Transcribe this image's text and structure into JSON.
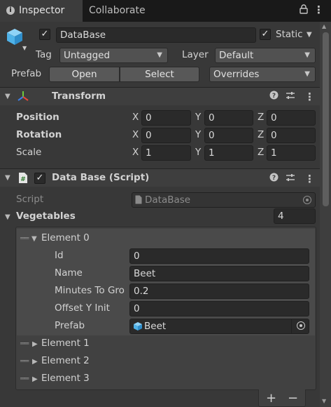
{
  "tabs": [
    {
      "label": "Inspector"
    },
    {
      "label": "Collaborate"
    }
  ],
  "header": {
    "object_name": "DataBase",
    "active": true,
    "static_label": "Static",
    "static": true,
    "tag_label": "Tag",
    "tag_value": "Untagged",
    "layer_label": "Layer",
    "layer_value": "Default",
    "prefab_label": "Prefab",
    "open_label": "Open",
    "select_label": "Select",
    "overrides_label": "Overrides"
  },
  "transform": {
    "title": "Transform",
    "rows": [
      {
        "label": "Position",
        "x": "0",
        "y": "0",
        "z": "0"
      },
      {
        "label": "Rotation",
        "x": "0",
        "y": "0",
        "z": "0"
      },
      {
        "label": "Scale",
        "x": "1",
        "y": "1",
        "z": "1"
      }
    ],
    "axis_x": "X",
    "axis_y": "Y",
    "axis_z": "Z"
  },
  "script_component": {
    "title": "Data Base (Script)",
    "enabled": true,
    "script_label": "Script",
    "script_value": "DataBase",
    "list_label": "Vegetables",
    "list_size": "4",
    "elements": [
      {
        "label": "Element 0",
        "expanded": true
      },
      {
        "label": "Element 1",
        "expanded": false
      },
      {
        "label": "Element 2",
        "expanded": false
      },
      {
        "label": "Element 3",
        "expanded": false
      }
    ],
    "element0_fields": {
      "id_label": "Id",
      "id_value": "0",
      "name_label": "Name",
      "name_value": "Beet",
      "minutes_label": "Minutes To Gro",
      "minutes_value": "0.2",
      "offset_label": "Offset Y Init",
      "offset_value": "0",
      "prefab_label": "Prefab",
      "prefab_value": "Beet"
    },
    "add_label": "+",
    "remove_label": "−"
  },
  "colors": {
    "background": "#383838",
    "tabbar": "#191919",
    "field": "#2a2a2a",
    "cube_blue": "#4fb2e8"
  }
}
